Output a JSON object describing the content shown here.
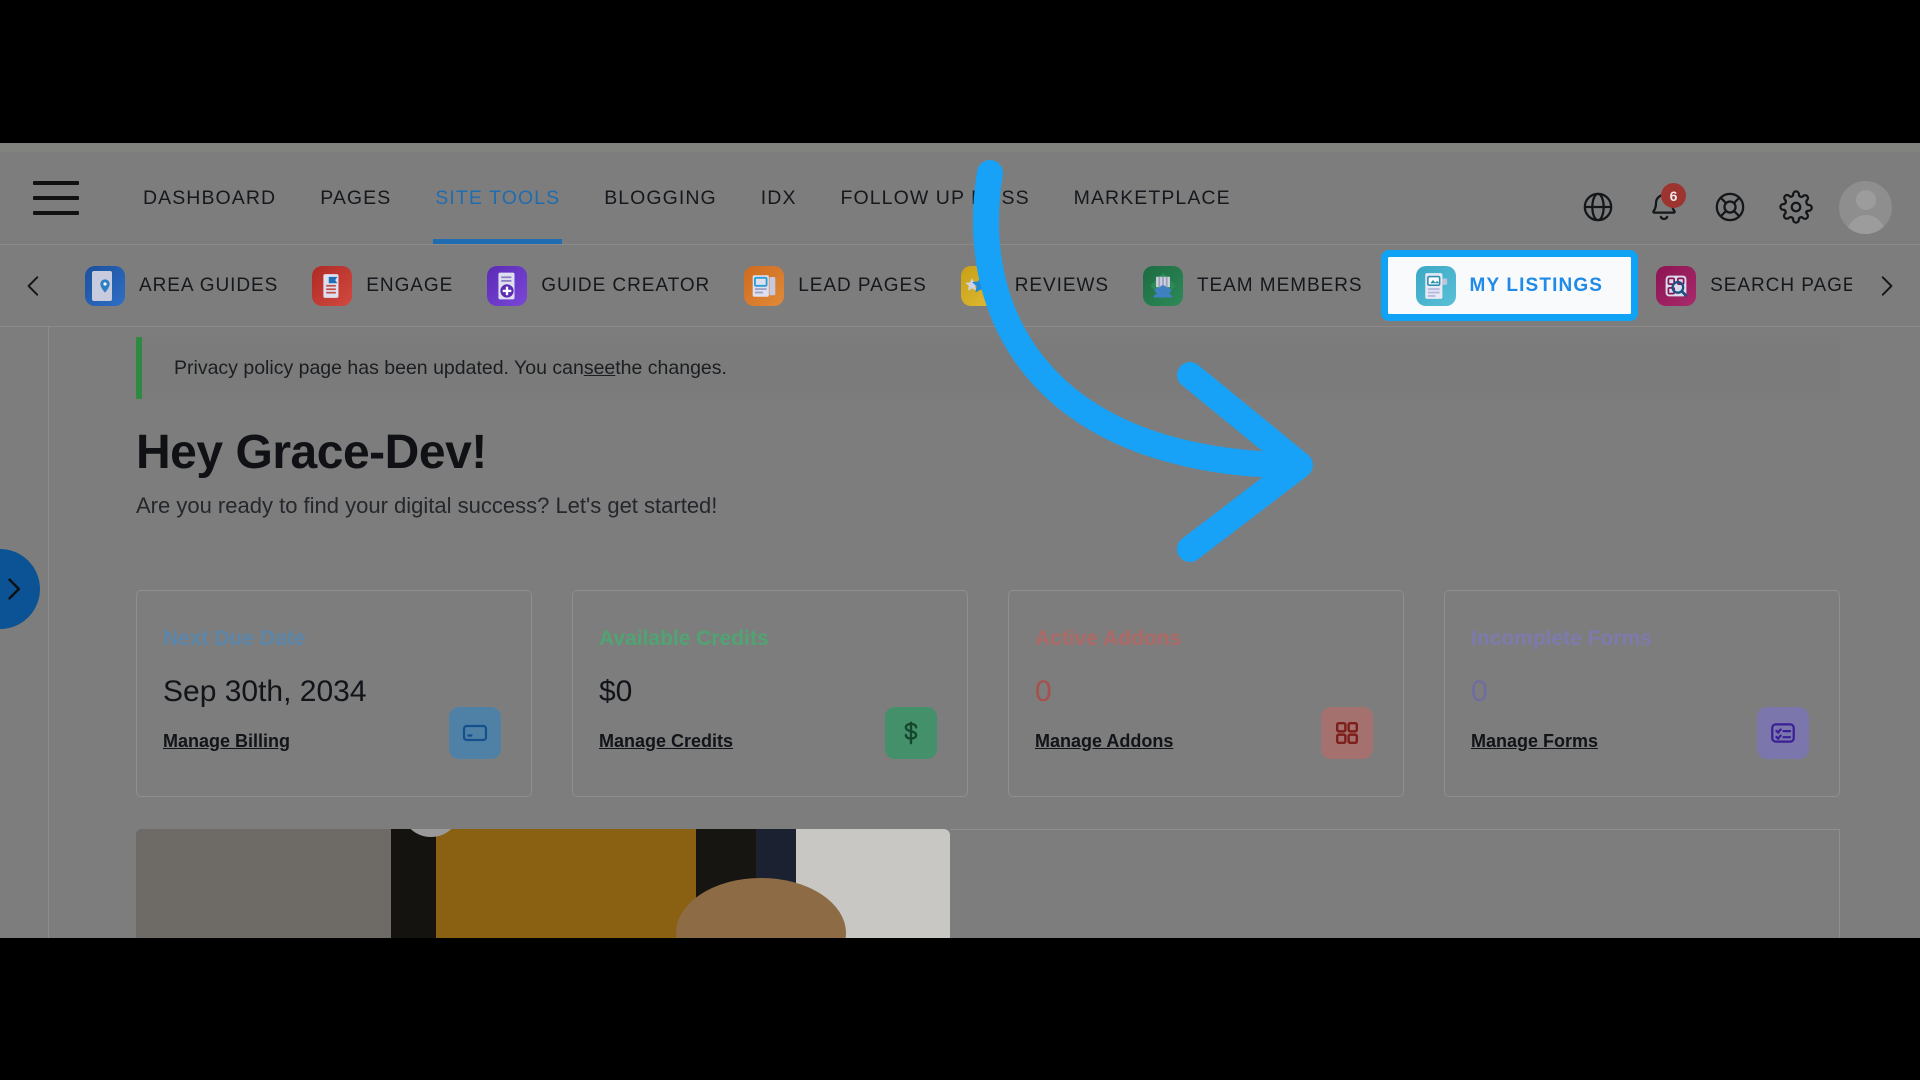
{
  "app": {
    "accent_blue": "#1f6cb0",
    "highlight_blue": "#10a2f5",
    "overlay_gray": "#7d7d7d"
  },
  "header": {
    "menu_icon": "hamburger-menu-icon",
    "nav": [
      {
        "label": "DASHBOARD",
        "active": false
      },
      {
        "label": "PAGES",
        "active": false
      },
      {
        "label": "SITE TOOLS",
        "active": true
      },
      {
        "label": "BLOGGING",
        "active": false
      },
      {
        "label": "IDX",
        "active": false
      },
      {
        "label": "FOLLOW UP BOSS",
        "active": false
      },
      {
        "label": "MARKETPLACE",
        "active": false
      }
    ],
    "icons": [
      {
        "name": "globe-icon",
        "label": "Language"
      },
      {
        "name": "bell-icon",
        "label": "Notifications",
        "badge": "6"
      },
      {
        "name": "lifebuoy-icon",
        "label": "Support"
      },
      {
        "name": "gear-icon",
        "label": "Settings"
      }
    ],
    "notification_count": "6",
    "avatar": "user-avatar"
  },
  "toolsbar": {
    "prev_label": "‹",
    "next_label": "›",
    "tools": [
      {
        "label": "AREA GUIDES",
        "icon": "area-guides-icon",
        "color1": "#1b4f9c",
        "color2": "#2f6fc4",
        "highlighted": false
      },
      {
        "label": "ENGAGE",
        "icon": "engage-icon",
        "color1": "#b02a25",
        "color2": "#d04a40",
        "highlighted": false
      },
      {
        "label": "GUIDE CREATOR",
        "icon": "guide-creator-icon",
        "color1": "#5b2bb5",
        "color2": "#7a46d8",
        "highlighted": false
      },
      {
        "label": "LEAD PAGES",
        "icon": "lead-pages-icon",
        "color1": "#cf6a1d",
        "color2": "#e08a3a",
        "highlighted": false
      },
      {
        "label": "REVIEWS",
        "icon": "reviews-icon",
        "color1": "#c9a017",
        "color2": "#e0bc34",
        "highlighted": false
      },
      {
        "label": "TEAM MEMBERS",
        "icon": "team-members-icon",
        "color1": "#1d6b42",
        "color2": "#2d8a57",
        "highlighted": false
      },
      {
        "label": "MY LISTINGS",
        "icon": "my-listings-icon",
        "color1": "#3aa8c4",
        "color2": "#5bc0d8",
        "highlighted": true
      },
      {
        "label": "SEARCH PAGES",
        "icon": "search-pages-icon",
        "color1": "#8c1452",
        "color2": "#a82a6c",
        "highlighted": false
      }
    ]
  },
  "notice": {
    "text_before": "Privacy policy page has been updated. You can ",
    "link": "see",
    "text_after": " the changes.",
    "accent": "#2d8a3e"
  },
  "greeting": {
    "title": "Hey Grace-Dev!",
    "subtitle": "Are you ready to find your digital success? Let's get started!"
  },
  "cards": [
    {
      "label": "Next Due Date",
      "label_color": "#5a87ab",
      "value": "Sep 30th, 2034",
      "value_color": "#111418",
      "link": "Manage Billing",
      "icon": "credit-card-icon",
      "icon_bg": "#4f81a6",
      "icon_fg": "#16508c"
    },
    {
      "label": "Available Credits",
      "label_color": "#4fa472",
      "value": "$0",
      "value_color": "#111418",
      "link": "Manage Credits",
      "icon": "dollar-sign-icon",
      "icon_bg": "#44906a",
      "icon_fg": "#13482f"
    },
    {
      "label": "Active Addons",
      "label_color": "#b06a66",
      "value": "0",
      "value_color": "#a8504c",
      "link": "Manage Addons",
      "icon": "grid-squares-icon",
      "icon_bg": "#a5716e",
      "icon_fg": "#7d1f1b"
    },
    {
      "label": "Incomplete Forms",
      "label_color": "#7d7aad",
      "value": "0",
      "value_color": "#6f6ca0",
      "link": "Manage Forms",
      "icon": "checklist-icon",
      "icon_bg": "#7b76ab",
      "icon_fg": "#3b1f96"
    }
  ],
  "pulltab": {
    "name": "expand-panel-tab",
    "glyph": "›",
    "color": "#0b5394"
  },
  "annotation": {
    "type": "curved-arrow",
    "color": "#17a2f7",
    "points_to": "MY LISTINGS"
  },
  "media": {
    "name": "tutorial-video-thumbnail"
  }
}
